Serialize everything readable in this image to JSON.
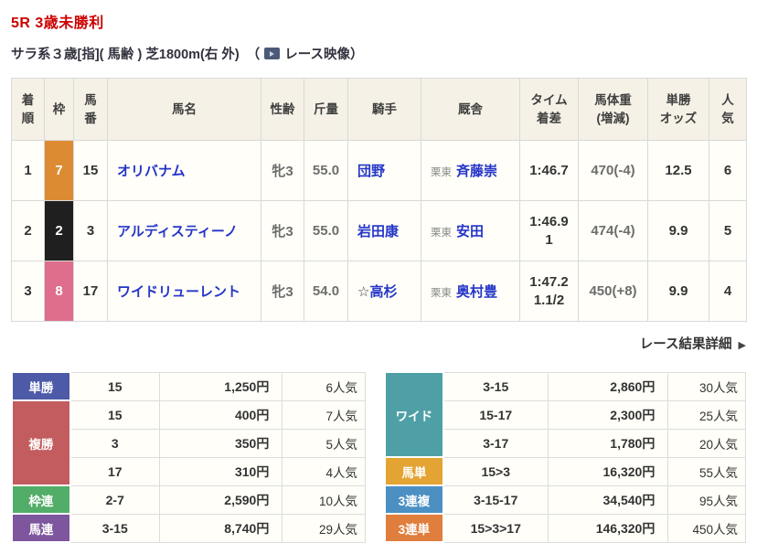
{
  "header": {
    "title": "5R 3歳未勝利",
    "conditions": "サラ系３歳[指]( 馬齢 ) 芝1800m(右 外)",
    "video_open": "（",
    "video_label": "レース映像",
    "video_close": "）"
  },
  "results": {
    "columns": [
      "着\n順",
      "枠",
      "馬\n番",
      "馬名",
      "性齢",
      "斤量",
      "騎手",
      "厩舎",
      "タイム\n着差",
      "馬体重\n(増減)",
      "単勝\nオッズ",
      "人\n気"
    ],
    "rows": [
      {
        "pos": "1",
        "frame": "7",
        "frame_color": "#dd8b33",
        "num": "15",
        "name": "オリバナム",
        "sexage": "牝3",
        "weight": "55.0",
        "jockey_prefix": "",
        "jockey": "団野",
        "stable_area": "栗東",
        "trainer": "斉藤崇",
        "time": "1:46.7",
        "margin": "",
        "body": "470(-4)",
        "odds": "12.5",
        "fav": "6"
      },
      {
        "pos": "2",
        "frame": "2",
        "frame_color": "#1f1f1f",
        "num": "3",
        "name": "アルディスティーノ",
        "sexage": "牝3",
        "weight": "55.0",
        "jockey_prefix": "",
        "jockey": "岩田康",
        "stable_area": "栗東",
        "trainer": "安田",
        "time": "1:46.9",
        "margin": "1",
        "body": "474(-4)",
        "odds": "9.9",
        "fav": "5"
      },
      {
        "pos": "3",
        "frame": "8",
        "frame_color": "#de6e8b",
        "num": "17",
        "name": "ワイドリューレント",
        "sexage": "牝3",
        "weight": "54.0",
        "jockey_prefix": "☆",
        "jockey": "高杉",
        "stable_area": "栗東",
        "trainer": "奥村豊",
        "time": "1:47.2",
        "margin": "1.1/2",
        "body": "450(+8)",
        "odds": "9.9",
        "fav": "4"
      }
    ]
  },
  "detail_link": {
    "label": "レース結果詳細",
    "arrow": "▶"
  },
  "payouts": {
    "left": [
      {
        "label": "単勝",
        "color": "#4d5aa8",
        "rows": [
          {
            "combo": "15",
            "amount": "1,250円",
            "fav": "6人気"
          }
        ]
      },
      {
        "label": "複勝",
        "color": "#c25c5e",
        "rows": [
          {
            "combo": "15",
            "amount": "400円",
            "fav": "7人気"
          },
          {
            "combo": "3",
            "amount": "350円",
            "fav": "5人気"
          },
          {
            "combo": "17",
            "amount": "310円",
            "fav": "4人気"
          }
        ]
      },
      {
        "label": "枠連",
        "color": "#52ad69",
        "rows": [
          {
            "combo": "2-7",
            "amount": "2,590円",
            "fav": "10人気"
          }
        ]
      },
      {
        "label": "馬連",
        "color": "#7e569e",
        "rows": [
          {
            "combo": "3-15",
            "amount": "8,740円",
            "fav": "29人気"
          }
        ]
      }
    ],
    "right": [
      {
        "label": "ワイド",
        "color": "#4fa0a6",
        "rows": [
          {
            "combo": "3-15",
            "amount": "2,860円",
            "fav": "30人気"
          },
          {
            "combo": "15-17",
            "amount": "2,300円",
            "fav": "25人気"
          },
          {
            "combo": "3-17",
            "amount": "1,780円",
            "fav": "20人気"
          }
        ]
      },
      {
        "label": "馬単",
        "color": "#e3a434",
        "rows": [
          {
            "combo": "15>3",
            "amount": "16,320円",
            "fav": "55人気"
          }
        ]
      },
      {
        "label": "3連複",
        "color": "#4c90c3",
        "rows": [
          {
            "combo": "3-15-17",
            "amount": "34,540円",
            "fav": "95人気"
          }
        ]
      },
      {
        "label": "3連単",
        "color": "#e07e3e",
        "rows": [
          {
            "combo": "15>3>17",
            "amount": "146,320円",
            "fav": "450人気"
          }
        ]
      }
    ]
  }
}
